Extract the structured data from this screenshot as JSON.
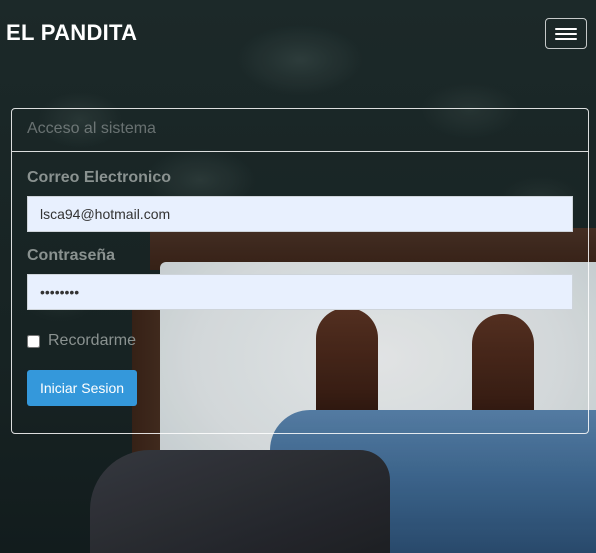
{
  "navbar": {
    "brand": "EL PANDITA",
    "toggle_icon": "hamburger-icon"
  },
  "login": {
    "header": "Acceso al sistema",
    "email_label": "Correo Electronico",
    "email_value": "lsca94@hotmail.com",
    "password_label": "Contraseña",
    "password_value": "••••••••",
    "remember_label": "Recordarme",
    "remember_checked": false,
    "submit_label": "Iniciar Sesion"
  },
  "colors": {
    "accent": "#3498db",
    "input_bg": "#e8f0fe"
  }
}
